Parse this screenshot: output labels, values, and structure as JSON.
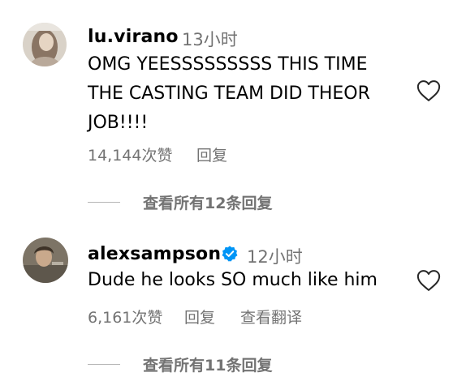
{
  "comments": [
    {
      "username": "lu.virano",
      "time": "13小时",
      "lines": [
        "OMG YEESSSSSSSSS THIS TIME",
        "THE CASTING TEAM DID THEOR",
        "JOB!!!!"
      ],
      "likes": "14,144次赞",
      "reply_label": "回复",
      "view_replies": "查看所有12条回复",
      "verified": false
    },
    {
      "username": "alexsampson",
      "time": "12小时",
      "lines": [
        "Dude he looks SO much like him"
      ],
      "likes": "6,161次赞",
      "reply_label": "回复",
      "translate_label": "查看翻译",
      "view_replies": "查看所有11条回复",
      "verified": true
    }
  ],
  "icons": {
    "like": "heart-outline-icon",
    "verified": "verified-badge-icon"
  },
  "colors": {
    "secondary_text": "#737373",
    "verified_blue": "#0095f6"
  }
}
